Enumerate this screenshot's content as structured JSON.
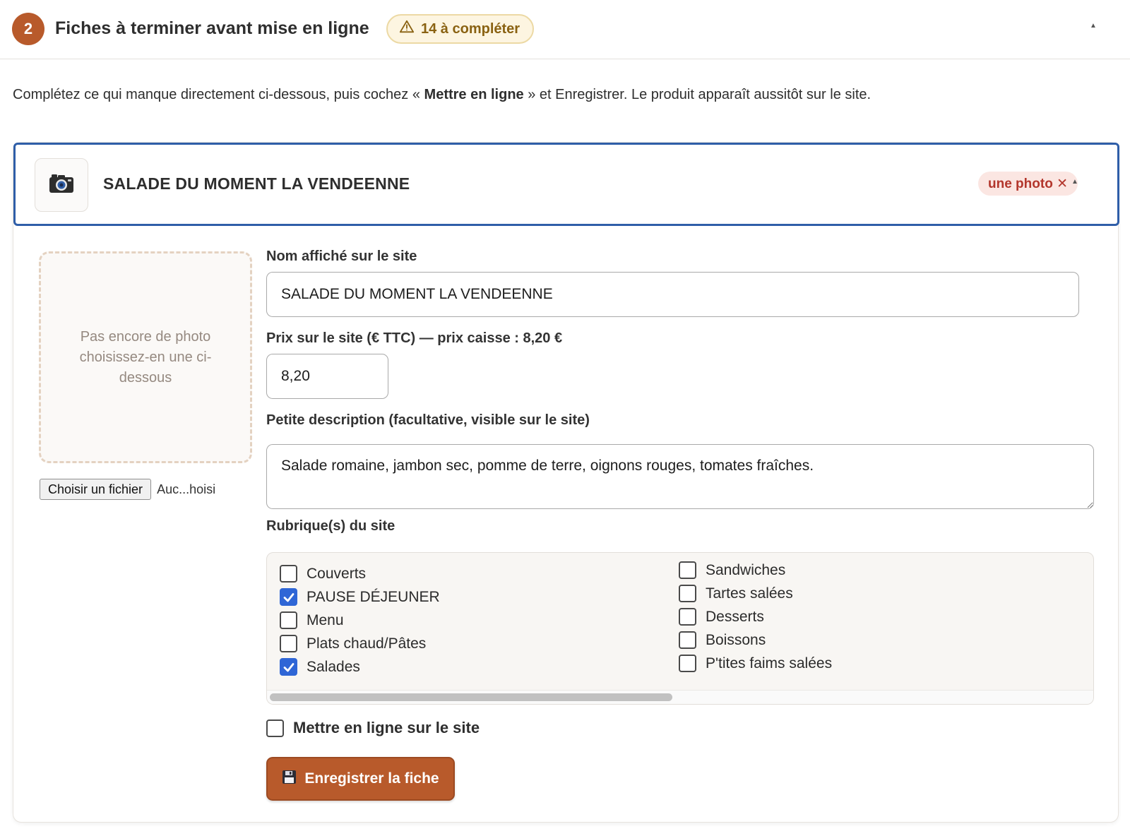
{
  "section": {
    "step": "2",
    "title": "Fiches à terminer avant mise en ligne",
    "badge": "14 à compléter"
  },
  "intro": {
    "before": "Complétez ce qui manque directement ci-dessous, puis cochez « ",
    "bold": "Mettre en ligne",
    "after": " » et Enregistrer. Le produit apparaît aussitôt sur le site."
  },
  "product": {
    "title": "SALADE DU MOMENT LA VENDEENNE",
    "missing_badge": "une photo ✕",
    "photo_placeholder": "Pas encore de photo choisissez-en une ci-dessous",
    "file_button": "Choisir un fichier",
    "file_name": "Auc...hoisi",
    "name_label": "Nom affiché sur le site",
    "name_value": "SALADE DU MOMENT LA VENDEENNE",
    "price_label": "Prix sur le site (€ TTC) — prix caisse : 8,20 €",
    "price_value": "8,20",
    "desc_label": "Petite description (facultative, visible sur le site)",
    "desc_value": "Salade romaine, jambon sec, pomme de terre, oignons rouges, tomates fraîches.",
    "categories_label": "Rubrique(s) du site",
    "categories_left": [
      {
        "label": "Couverts",
        "checked": false
      },
      {
        "label": "PAUSE DÉJEUNER",
        "checked": true
      },
      {
        "label": "Menu",
        "checked": false
      },
      {
        "label": "Plats chaud/Pâtes",
        "checked": false
      },
      {
        "label": "Salades",
        "checked": true
      }
    ],
    "categories_right": [
      {
        "label": "Sandwiches",
        "checked": false
      },
      {
        "label": "Tartes salées",
        "checked": false
      },
      {
        "label": "Desserts",
        "checked": false
      },
      {
        "label": "Boissons",
        "checked": false
      },
      {
        "label": "P'tites faims salées",
        "checked": false
      }
    ],
    "publish_label": "Mettre en ligne sur le site",
    "publish_checked": false,
    "save_label": "Enregistrer la fiche"
  },
  "colors": {
    "accent": "#b85a2b",
    "focus_border": "#2f5ea8",
    "checkbox_on": "#2f66d6",
    "warning_text": "#8a6212",
    "error_text": "#b3362c"
  },
  "icons": {
    "warning": "warning-triangle-icon",
    "camera": "camera-icon",
    "save": "floppy-disk-icon",
    "collapse": "caret-up-icon"
  }
}
